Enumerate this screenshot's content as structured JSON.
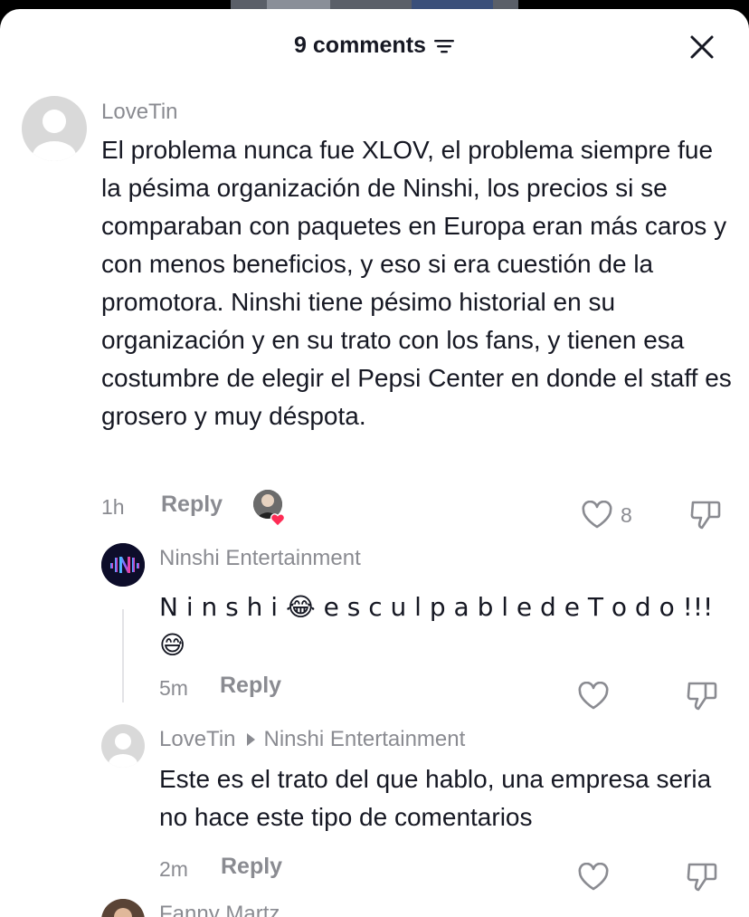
{
  "header": {
    "comment_count": "9 comments"
  },
  "comments": [
    {
      "username": "LoveTin",
      "text": "El problema nunca fue XLOV, el problema siempre fue la pésima organización de Ninshi, los precios si se comparaban con paquetes en Europa eran más caros y con menos beneficios, y eso si era cuestión de la promotora. Ninshi tiene pésimo historial en su organización y en su trato con los fans, y tienen esa costumbre de elegir el Pepsi Center en donde el staff es grosero y muy déspota.",
      "time": "1h",
      "reply_label": "Reply",
      "likes": "8"
    }
  ],
  "replies": [
    {
      "username": "Ninshi Entertainment",
      "text": "N i n s h i 😂 e s c u l p a b l e d e T o d o !!! 😅",
      "time": "5m",
      "reply_label": "Reply"
    },
    {
      "username": "LoveTin",
      "reply_to": "Ninshi Entertainment",
      "text": "Este es el trato del que hablo, una empresa seria no hace este tipo de comentarios",
      "time": "2m",
      "reply_label": "Reply"
    }
  ],
  "next_comment": {
    "username": "Fanny Martz"
  },
  "colors": {
    "accent_like": "#fe2c55",
    "meta_gray": "#8a8b91",
    "text": "#161823"
  }
}
